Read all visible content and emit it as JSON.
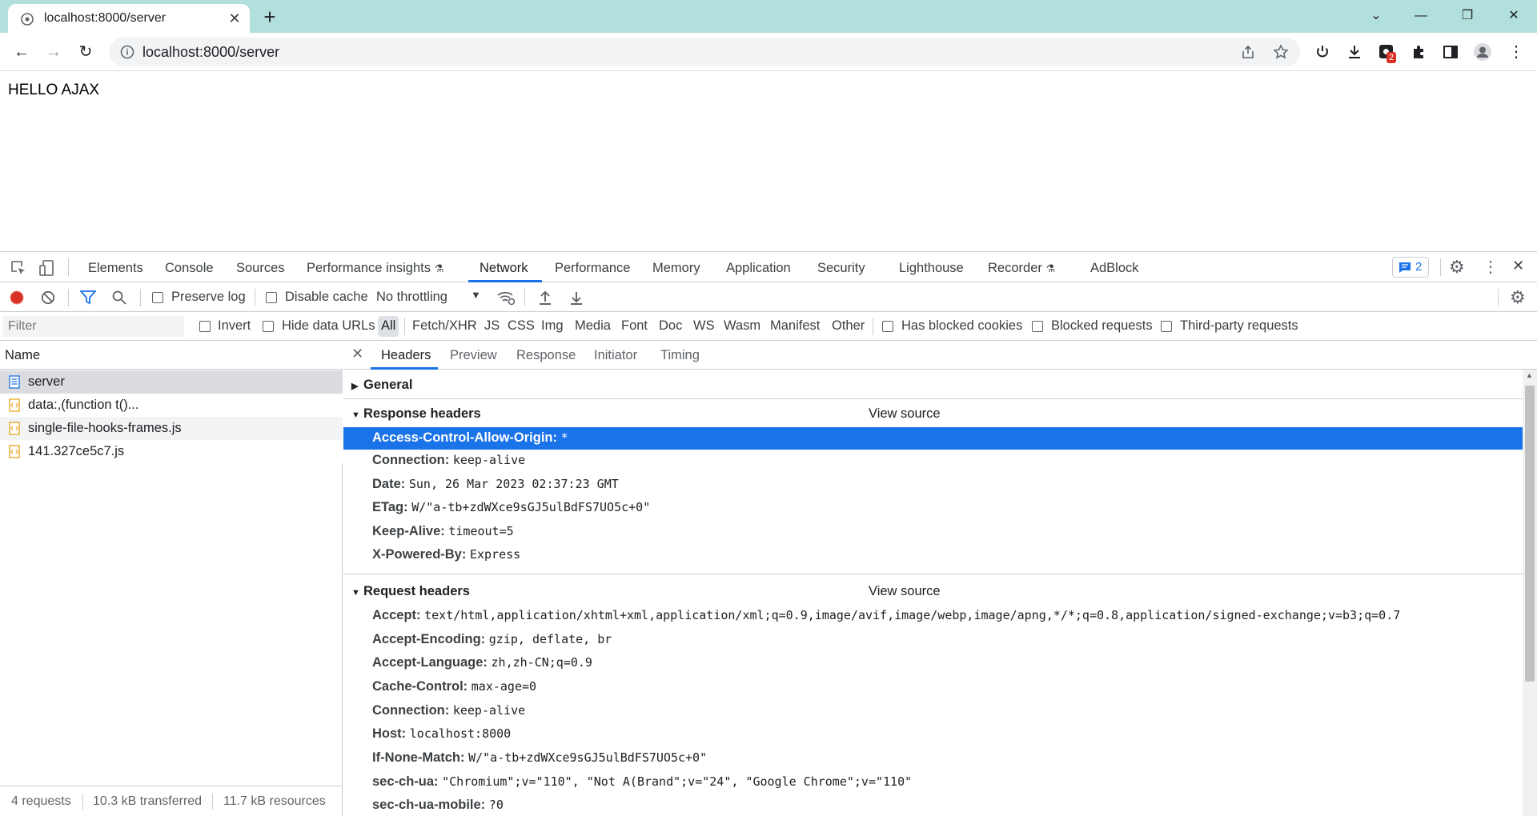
{
  "browser": {
    "tab_title": "localhost:8000/server",
    "url": "localhost:8000/server",
    "extension_badge": "2"
  },
  "page": {
    "text": "HELLO AJAX"
  },
  "devtools": {
    "tabs": [
      "Elements",
      "Console",
      "Sources",
      "Performance insights",
      "Network",
      "Performance",
      "Memory",
      "Application",
      "Security",
      "Lighthouse",
      "Recorder",
      "AdBlock"
    ],
    "active_tab": "Network",
    "issues_count": "2",
    "toolbar": {
      "preserve_log": "Preserve log",
      "disable_cache": "Disable cache",
      "throttling": "No throttling"
    },
    "filter": {
      "placeholder": "Filter",
      "invert": "Invert",
      "hide_data_urls": "Hide data URLs",
      "types": [
        "All",
        "Fetch/XHR",
        "JS",
        "CSS",
        "Img",
        "Media",
        "Font",
        "Doc",
        "WS",
        "Wasm",
        "Manifest",
        "Other"
      ],
      "has_blocked_cookies": "Has blocked cookies",
      "blocked_requests": "Blocked requests",
      "third_party": "Third-party requests"
    },
    "requests": {
      "header": "Name",
      "items": [
        "server",
        "data:,(function t()...",
        "single-file-hooks-frames.js",
        "141.327ce5c7.js"
      ]
    },
    "status": {
      "requests": "4 requests",
      "transferred": "10.3 kB transferred",
      "resources": "11.7 kB resources"
    },
    "detail_tabs": [
      "Headers",
      "Preview",
      "Response",
      "Initiator",
      "Timing"
    ],
    "sections": {
      "general": "General",
      "response": "Response headers",
      "request": "Request headers",
      "view_source": "View source"
    },
    "response_headers": [
      {
        "k": "Access-Control-Allow-Origin:",
        "v": "*"
      },
      {
        "k": "Connection:",
        "v": "keep-alive"
      },
      {
        "k": "Date:",
        "v": "Sun, 26 Mar 2023 02:37:23 GMT"
      },
      {
        "k": "ETag:",
        "v": "W/\"a-tb+zdWXce9sGJ5ulBdFS7UO5c+0\""
      },
      {
        "k": "Keep-Alive:",
        "v": "timeout=5"
      },
      {
        "k": "X-Powered-By:",
        "v": "Express"
      }
    ],
    "request_headers": [
      {
        "k": "Accept:",
        "v": "text/html,application/xhtml+xml,application/xml;q=0.9,image/avif,image/webp,image/apng,*/*;q=0.8,application/signed-exchange;v=b3;q=0.7"
      },
      {
        "k": "Accept-Encoding:",
        "v": "gzip, deflate, br"
      },
      {
        "k": "Accept-Language:",
        "v": "zh,zh-CN;q=0.9"
      },
      {
        "k": "Cache-Control:",
        "v": "max-age=0"
      },
      {
        "k": "Connection:",
        "v": "keep-alive"
      },
      {
        "k": "Host:",
        "v": "localhost:8000"
      },
      {
        "k": "If-None-Match:",
        "v": "W/\"a-tb+zdWXce9sGJ5ulBdFS7UO5c+0\""
      },
      {
        "k": "sec-ch-ua:",
        "v": "\"Chromium\";v=\"110\", \"Not A(Brand\";v=\"24\", \"Google Chrome\";v=\"110\""
      },
      {
        "k": "sec-ch-ua-mobile:",
        "v": "?0"
      }
    ]
  }
}
